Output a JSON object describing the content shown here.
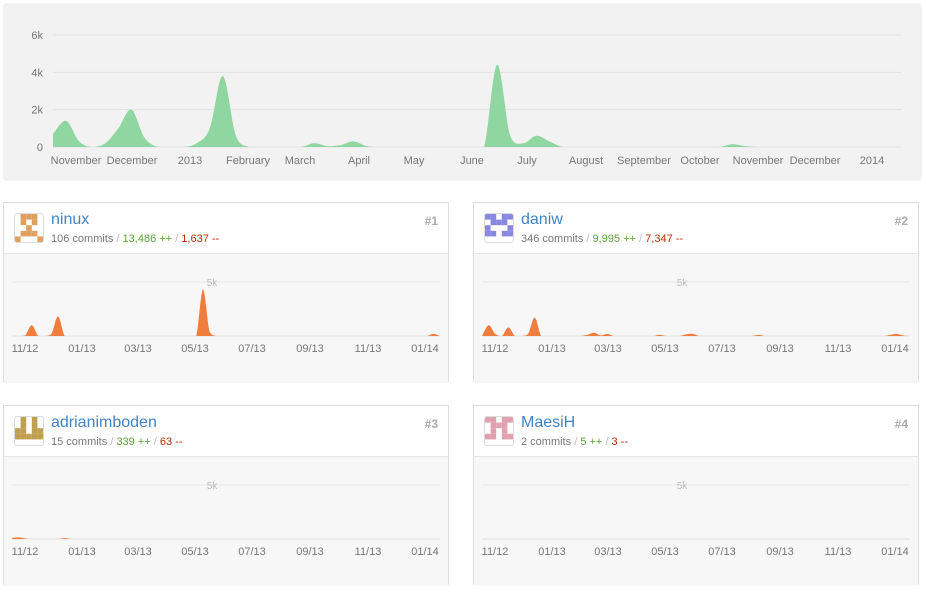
{
  "main_chart": {
    "color": "#8fd6a0",
    "y_ticks": [
      "6k",
      "4k",
      "2k",
      "0"
    ],
    "x_labels": [
      "November",
      "December",
      "2013",
      "February",
      "March",
      "April",
      "May",
      "June",
      "July",
      "August",
      "September",
      "October",
      "November",
      "December",
      "2014"
    ]
  },
  "chart_data": {
    "type": "area",
    "x": [
      "2012-10-28",
      "2012-11-04",
      "2012-11-11",
      "2012-11-18",
      "2012-11-25",
      "2012-12-02",
      "2012-12-09",
      "2012-12-16",
      "2012-12-23",
      "2012-12-30",
      "2013-01-06",
      "2013-01-13",
      "2013-01-20",
      "2013-01-27",
      "2013-02-03",
      "2013-02-10",
      "2013-02-17",
      "2013-02-24",
      "2013-03-03",
      "2013-03-10",
      "2013-03-17",
      "2013-03-24",
      "2013-03-31",
      "2013-04-07",
      "2013-04-14",
      "2013-04-21",
      "2013-04-28",
      "2013-05-05",
      "2013-05-12",
      "2013-05-19",
      "2013-05-26",
      "2013-06-02",
      "2013-06-09",
      "2013-06-16",
      "2013-06-23",
      "2013-06-30",
      "2013-07-07",
      "2013-07-14",
      "2013-07-21",
      "2013-07-28",
      "2013-08-04",
      "2013-08-11",
      "2013-08-18",
      "2013-08-25",
      "2013-09-01",
      "2013-09-08",
      "2013-09-15",
      "2013-09-22",
      "2013-09-29",
      "2013-10-06",
      "2013-10-13",
      "2013-10-20",
      "2013-10-27",
      "2013-11-03",
      "2013-11-10",
      "2013-11-17",
      "2013-11-24",
      "2013-12-01",
      "2013-12-08",
      "2013-12-15",
      "2013-12-22",
      "2013-12-29",
      "2014-01-05",
      "2014-01-12",
      "2014-01-19",
      "2014-01-26"
    ],
    "series": [
      {
        "values": [
          700,
          1400,
          300,
          0,
          200,
          1000,
          2000,
          500,
          0,
          0,
          0,
          200,
          1000,
          3800,
          600,
          0,
          0,
          0,
          0,
          0,
          200,
          50,
          100,
          300,
          50,
          0,
          0,
          0,
          0,
          0,
          0,
          0,
          0,
          0,
          4400,
          600,
          200,
          600,
          300,
          0,
          0,
          0,
          0,
          0,
          0,
          0,
          0,
          0,
          0,
          0,
          0,
          0,
          150,
          50,
          0,
          0,
          0,
          0,
          0,
          0,
          0,
          0,
          0,
          0,
          0,
          0
        ]
      }
    ],
    "ylim": [
      0,
      6000
    ]
  },
  "card_chart": {
    "color": "#f07d3e",
    "gridline_label": "5k",
    "x_labels": [
      "11/12",
      "01/13",
      "03/13",
      "05/13",
      "07/13",
      "09/13",
      "11/13",
      "01/14"
    ]
  },
  "contributors": [
    {
      "name": "ninux",
      "commits": "106 commits",
      "additions": "13,486 ++",
      "deletions": "1,637 --",
      "rank": "#1",
      "avatar_color": "#e0a060",
      "values": [
        0,
        0,
        50,
        1000,
        0,
        0,
        200,
        1800,
        0,
        0,
        0,
        0,
        0,
        0,
        0,
        0,
        0,
        0,
        0,
        0,
        0,
        0,
        0,
        0,
        0,
        0,
        0,
        0,
        0,
        4300,
        400,
        0,
        0,
        0,
        0,
        0,
        0,
        0,
        0,
        0,
        0,
        0,
        0,
        0,
        0,
        0,
        0,
        0,
        0,
        0,
        0,
        0,
        0,
        0,
        0,
        0,
        0,
        0,
        0,
        0,
        0,
        0,
        0,
        0,
        200,
        0
      ]
    },
    {
      "name": "daniw",
      "commits": "346 commits",
      "additions": "9,995 ++",
      "deletions": "7,347 --",
      "rank": "#2",
      "avatar_color": "#8888e0",
      "values": [
        0,
        1000,
        200,
        0,
        800,
        0,
        0,
        200,
        1700,
        0,
        0,
        0,
        0,
        0,
        0,
        0,
        100,
        300,
        50,
        200,
        0,
        0,
        0,
        0,
        0,
        0,
        0,
        100,
        0,
        0,
        0,
        150,
        200,
        0,
        0,
        0,
        0,
        0,
        0,
        0,
        0,
        0,
        100,
        0,
        0,
        0,
        0,
        0,
        0,
        0,
        0,
        0,
        0,
        0,
        0,
        0,
        0,
        0,
        0,
        0,
        0,
        0,
        100,
        200,
        50,
        0
      ]
    },
    {
      "name": "adrianimboden",
      "commits": "15 commits",
      "additions": "339 ++",
      "deletions": "63 --",
      "rank": "#3",
      "avatar_color": "#c0a050",
      "values": [
        100,
        150,
        50,
        0,
        0,
        0,
        0,
        0,
        80,
        0,
        0,
        0,
        0,
        0,
        0,
        0,
        0,
        0,
        0,
        0,
        0,
        0,
        0,
        0,
        0,
        0,
        0,
        0,
        0,
        0,
        0,
        0,
        0,
        0,
        0,
        0,
        0,
        0,
        0,
        0,
        0,
        0,
        0,
        0,
        0,
        0,
        0,
        0,
        0,
        0,
        0,
        0,
        0,
        0,
        0,
        0,
        0,
        0,
        0,
        0,
        0,
        0,
        0,
        0,
        0,
        0
      ]
    },
    {
      "name": "MaesiH",
      "commits": "2 commits",
      "additions": "5 ++",
      "deletions": "3 --",
      "rank": "#4",
      "avatar_color": "#e0a0b0",
      "values": [
        0,
        0,
        0,
        0,
        0,
        0,
        0,
        0,
        0,
        0,
        0,
        0,
        0,
        0,
        0,
        0,
        0,
        0,
        0,
        0,
        0,
        0,
        0,
        0,
        0,
        0,
        0,
        0,
        0,
        0,
        0,
        0,
        0,
        0,
        0,
        0,
        0,
        0,
        0,
        0,
        0,
        0,
        0,
        0,
        0,
        0,
        0,
        0,
        0,
        0,
        0,
        0,
        0,
        0,
        0,
        0,
        0,
        0,
        0,
        0,
        0,
        0,
        0,
        0,
        0,
        0
      ]
    }
  ]
}
